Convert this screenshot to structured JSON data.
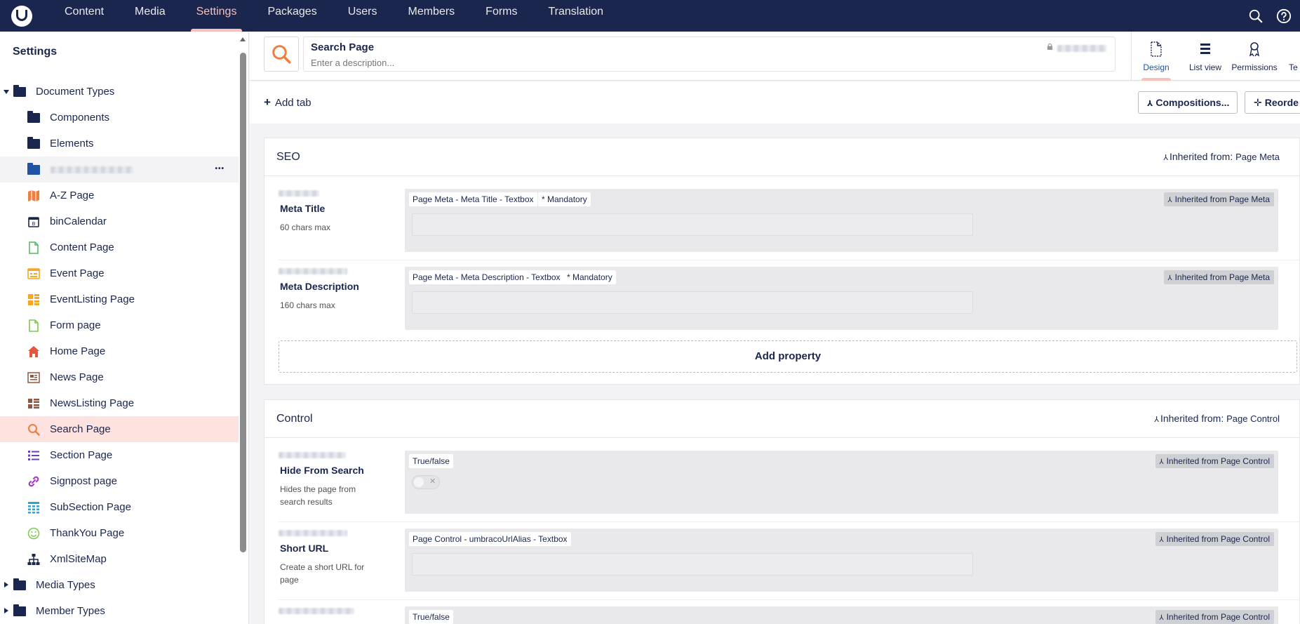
{
  "colors": {
    "topbar": "#1b264f",
    "accent": "#f5c1bc",
    "selected_row": "#fde2df",
    "link_blue": "#2152a3"
  },
  "nav": {
    "items": [
      {
        "label": "Content"
      },
      {
        "label": "Media"
      },
      {
        "label": "Settings",
        "active": true
      },
      {
        "label": "Packages"
      },
      {
        "label": "Users"
      },
      {
        "label": "Members"
      },
      {
        "label": "Forms"
      },
      {
        "label": "Translation"
      }
    ],
    "right_icons": [
      "search-icon",
      "help-icon"
    ]
  },
  "sidebar": {
    "title": "Settings",
    "tree": [
      {
        "label": "Document Types",
        "icon": "folder-icon",
        "level": 0,
        "caret": "down"
      },
      {
        "label": "Components",
        "icon": "folder-icon",
        "level": 1,
        "caret": "right"
      },
      {
        "label": "Elements",
        "icon": "folder-icon",
        "level": 1,
        "caret": "right"
      },
      {
        "label": "",
        "icon": "folder-icon",
        "level": 1,
        "caret": "right",
        "redacted": true,
        "has_menu": true
      },
      {
        "label": "A-Z Page",
        "icon": "map-icon",
        "level": 1,
        "color": "#f07e3e"
      },
      {
        "label": "binCalendar",
        "icon": "calendar-icon",
        "level": 1,
        "color": "#1b264f"
      },
      {
        "label": "Content Page",
        "icon": "document-icon",
        "level": 1,
        "color": "#51b85a"
      },
      {
        "label": "Event Page",
        "icon": "event-icon",
        "level": 1,
        "color": "#f5a623"
      },
      {
        "label": "EventListing Page",
        "icon": "grid-icon",
        "level": 1,
        "color": "#f5a623"
      },
      {
        "label": "Form page",
        "icon": "form-icon",
        "level": 1,
        "color": "#7fc94a"
      },
      {
        "label": "Home Page",
        "icon": "home-icon",
        "level": 1,
        "color": "#e5553c"
      },
      {
        "label": "News Page",
        "icon": "news-icon",
        "level": 1,
        "color": "#8a5a44"
      },
      {
        "label": "NewsListing Page",
        "icon": "list-grid-icon",
        "level": 1,
        "color": "#8a5a44"
      },
      {
        "label": "Search Page",
        "icon": "search-icon",
        "level": 1,
        "color": "#f07e3e",
        "selected": true
      },
      {
        "label": "Section Page",
        "icon": "bullet-list-icon",
        "level": 1,
        "color": "#6d3cbf"
      },
      {
        "label": "Signpost page",
        "icon": "link-icon",
        "level": 1,
        "color": "#a233c5"
      },
      {
        "label": "SubSection Page",
        "icon": "table-icon",
        "level": 1,
        "color": "#2ea3d9"
      },
      {
        "label": "ThankYou Page",
        "icon": "smiley-icon",
        "level": 1,
        "color": "#7fc94a"
      },
      {
        "label": "XmlSiteMap",
        "icon": "sitemap-icon",
        "level": 1,
        "color": "#1b264f"
      },
      {
        "label": "Media Types",
        "icon": "folder-icon",
        "level": 0,
        "caret": "right"
      },
      {
        "label": "Member Types",
        "icon": "folder-icon",
        "level": 0,
        "caret": "right"
      }
    ]
  },
  "header": {
    "name": "Search Page",
    "description_placeholder": "Enter a description...",
    "apps": [
      {
        "label": "Design",
        "icon": "design-icon",
        "active": true
      },
      {
        "label": "List view",
        "icon": "list-view-icon"
      },
      {
        "label": "Permissions",
        "icon": "permissions-icon"
      },
      {
        "label": "Te",
        "icon": "templates-icon"
      }
    ]
  },
  "toolbar": {
    "add_tab": "Add tab",
    "compositions": "Compositions...",
    "reorder": "Reorde"
  },
  "groups": [
    {
      "name": "SEO",
      "inherited_label": "Inherited from:",
      "inherited_from": "Page Meta",
      "add_property": "Add property",
      "properties": [
        {
          "name": "Meta Title",
          "description": "60 chars max",
          "editor": "Page Meta - Meta Title - Textbox",
          "mandatory": "* Mandatory",
          "inherited": "Inherited from Page Meta",
          "type": "input"
        },
        {
          "name": "Meta Description",
          "description": "160 chars max",
          "editor": "Page Meta - Meta Description - Textbox",
          "mandatory": "* Mandatory",
          "inherited": "Inherited from Page Meta",
          "type": "input"
        }
      ]
    },
    {
      "name": "Control",
      "inherited_label": "Inherited from:",
      "inherited_from": "Page Control",
      "properties": [
        {
          "name": "Hide From Search",
          "description": "Hides the page from search results",
          "editor": "True/false",
          "inherited": "Inherited from Page Control",
          "type": "toggle"
        },
        {
          "name": "Short URL",
          "description": "Create a short URL for page",
          "editor": "Page Control - umbracoUrlAlias - Textbox",
          "inherited": "Inherited from Page Control",
          "type": "input"
        },
        {
          "name": "",
          "description": "",
          "editor": "True/false",
          "inherited": "Inherited from Page Control",
          "type": "partial"
        }
      ]
    }
  ]
}
